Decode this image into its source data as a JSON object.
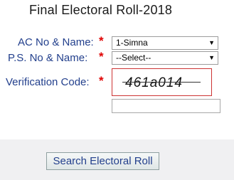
{
  "form": {
    "title": "Final Electoral Roll-2018",
    "ac_label": "AC No & Name:",
    "ac_value": "1-Simna",
    "ps_label": "P.S. No & Name:",
    "ps_value": "--Select--",
    "verification_label": "Verification Code:",
    "captcha_text": "461a014",
    "code_value": "",
    "required_marker": "*",
    "submit_label": "Search Electoral Roll"
  }
}
